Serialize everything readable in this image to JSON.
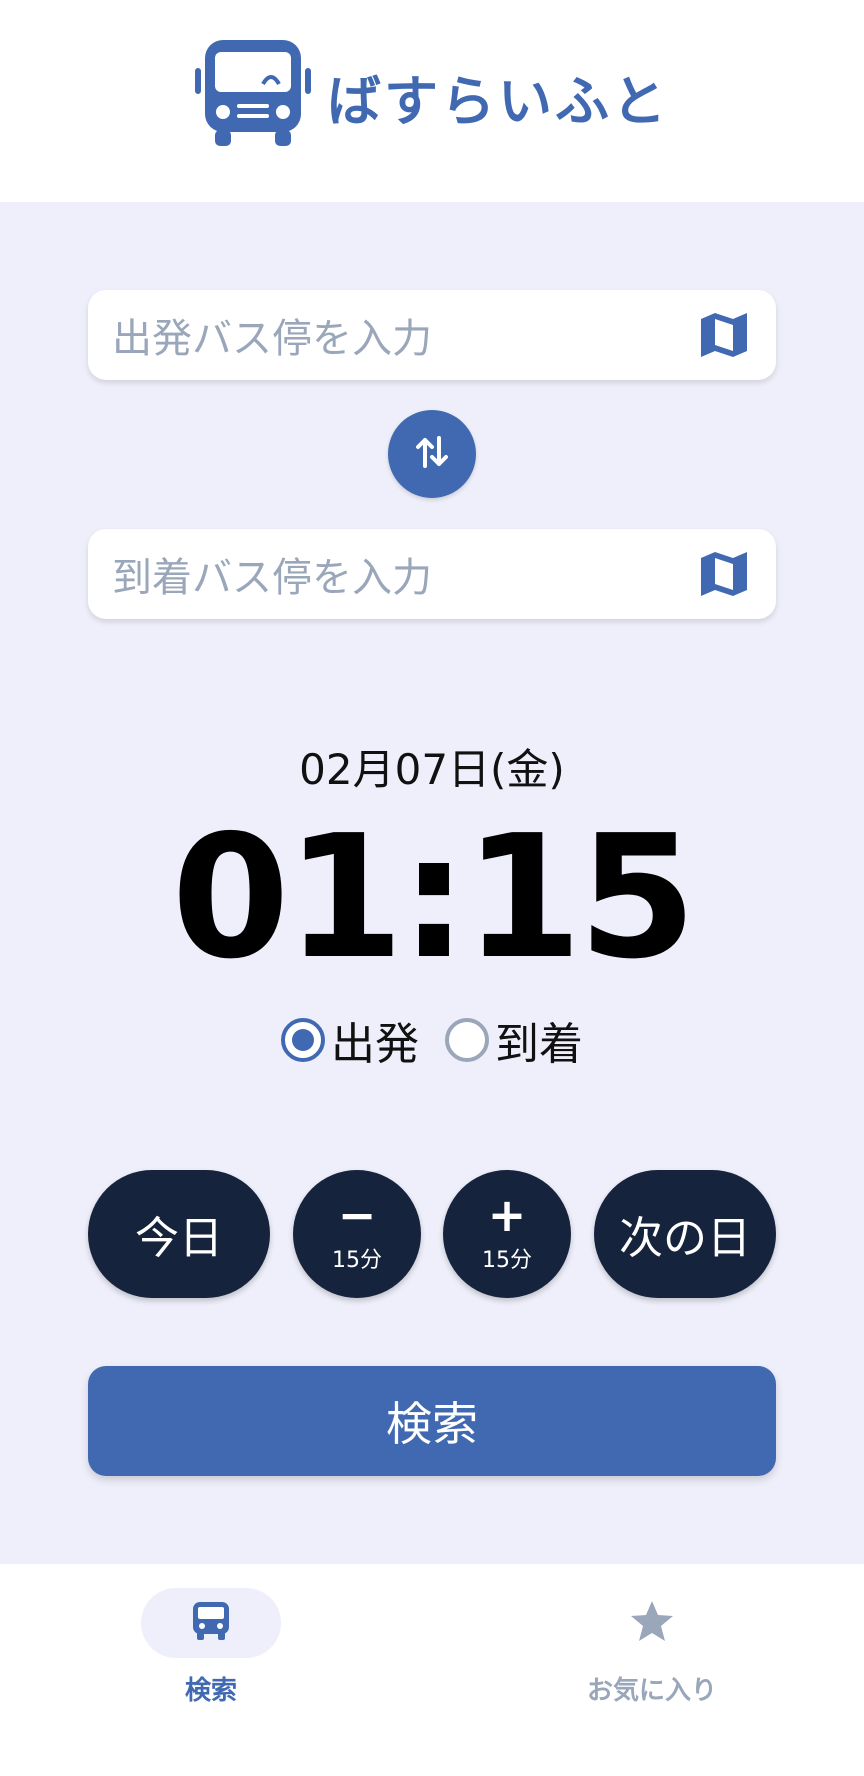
{
  "app": {
    "title": "ばすらいふと"
  },
  "colors": {
    "primary": "#4169b2",
    "dark": "#16233d",
    "background": "#eeeffa",
    "muted": "#9aa6ba"
  },
  "search_form": {
    "departure_placeholder": "出発バス停を入力",
    "arrival_placeholder": "到着バス停を入力",
    "map_icon": "map-icon",
    "swap_icon": "swap-vertical-icon"
  },
  "datetime": {
    "date": "02月07日(金)",
    "time": "01:15",
    "mode_options": [
      {
        "label": "出発",
        "selected": true
      },
      {
        "label": "到着",
        "selected": false
      }
    ]
  },
  "time_buttons": {
    "today": "今日",
    "minus_symbol": "−",
    "minus_sub": "15分",
    "plus_symbol": "+",
    "plus_sub": "15分",
    "next_day": "次の日"
  },
  "search_button": "検索",
  "bottom_nav": [
    {
      "label": "検索",
      "icon": "bus-icon",
      "active": true
    },
    {
      "label": "お気に入り",
      "icon": "star-icon",
      "active": false
    }
  ]
}
